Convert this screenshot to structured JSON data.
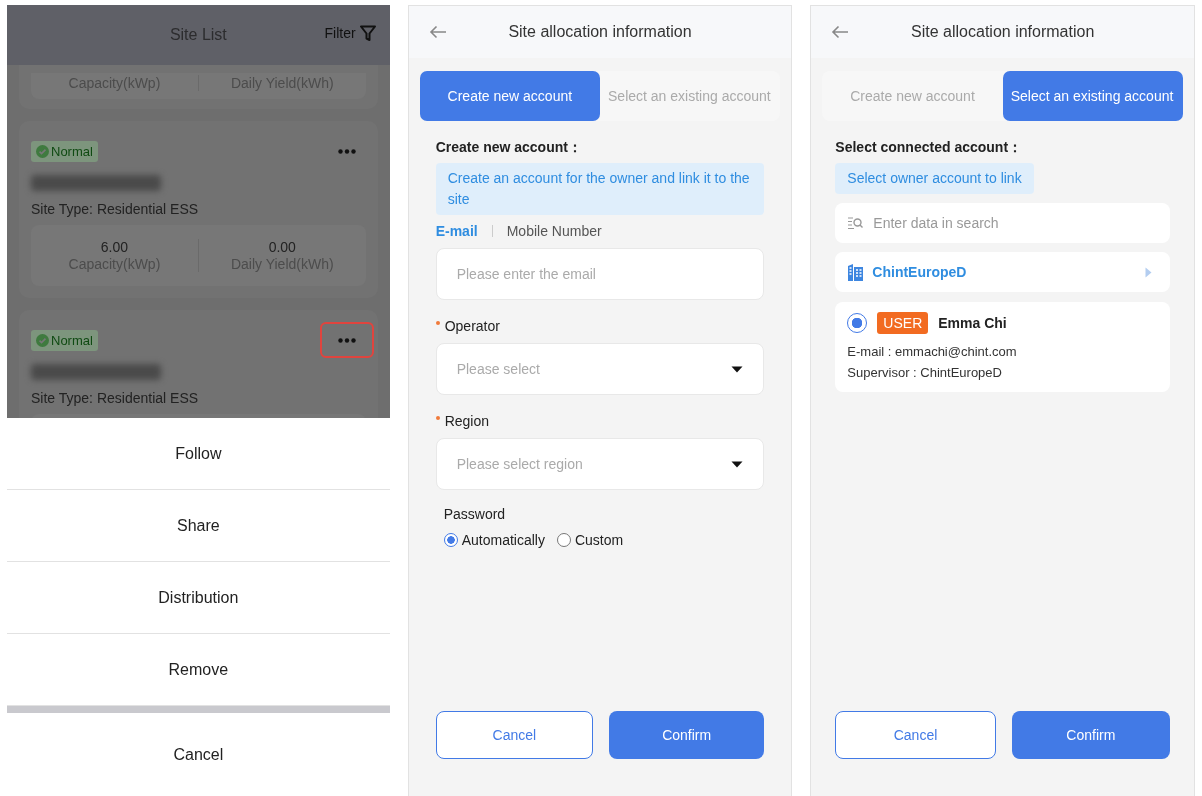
{
  "site_list": {
    "title": "Site List",
    "filter_label": "Filter",
    "partial_card": {
      "capacity_label": "Capacity(kWp)",
      "yield_label": "Daily Yield(kWh)"
    },
    "sites": [
      {
        "status": "Normal",
        "site_type": "Site Type: Residential ESS",
        "stats": {
          "capacity": "6.00",
          "capacity_label": "Capacity(kWp)",
          "daily_yield": "0.00",
          "yield_label": "Daily Yield(kWh)"
        },
        "menu_highlighted": false
      },
      {
        "status": "Normal",
        "site_type": "Site Type: Residential ESS",
        "menu_highlighted": true
      }
    ]
  },
  "action_sheet": {
    "items": [
      "Follow",
      "Share",
      "Distribution",
      "Remove"
    ],
    "cancel": "Cancel"
  },
  "create_panel": {
    "title": "Site allocation information",
    "tabs": [
      {
        "label": "Create new account",
        "selected": true
      },
      {
        "label": "Select an existing account",
        "selected": false
      }
    ],
    "section_title": "Create new account：",
    "hint": "Create an account for the owner and link it to the site",
    "contact_tabs": [
      {
        "label": "E-mail",
        "selected": true
      },
      {
        "label": "Mobile Number",
        "selected": false
      }
    ],
    "email_placeholder": "Please enter the email",
    "fields": [
      {
        "label": "Operator",
        "required": true,
        "placeholder": "Please select"
      },
      {
        "label": "Region",
        "required": true,
        "placeholder": "Please select region"
      }
    ],
    "password_label": "Password",
    "password_options": [
      {
        "label": "Automatically",
        "selected": true
      },
      {
        "label": "Custom",
        "selected": false
      }
    ],
    "buttons": [
      {
        "label": "Cancel",
        "kind": "outline"
      },
      {
        "label": "Confirm",
        "kind": "primary"
      }
    ]
  },
  "select_panel": {
    "title": "Site allocation information",
    "tabs": [
      {
        "label": "Create new account",
        "selected": false
      },
      {
        "label": "Select an existing account",
        "selected": true
      }
    ],
    "section_title": "Select connected account：",
    "hint": "Select owner account to link",
    "search_placeholder": "Enter data in search",
    "org": {
      "name": "ChintEuropeD"
    },
    "account": {
      "selected": true,
      "role": "USER",
      "name": "Emma Chi",
      "email_line": "E-mail : emmachi@chint.com",
      "supervisor_line": "Supervisor : ChintEuropeD"
    },
    "buttons": [
      {
        "label": "Cancel",
        "kind": "outline"
      },
      {
        "label": "Confirm",
        "kind": "primary"
      }
    ]
  }
}
